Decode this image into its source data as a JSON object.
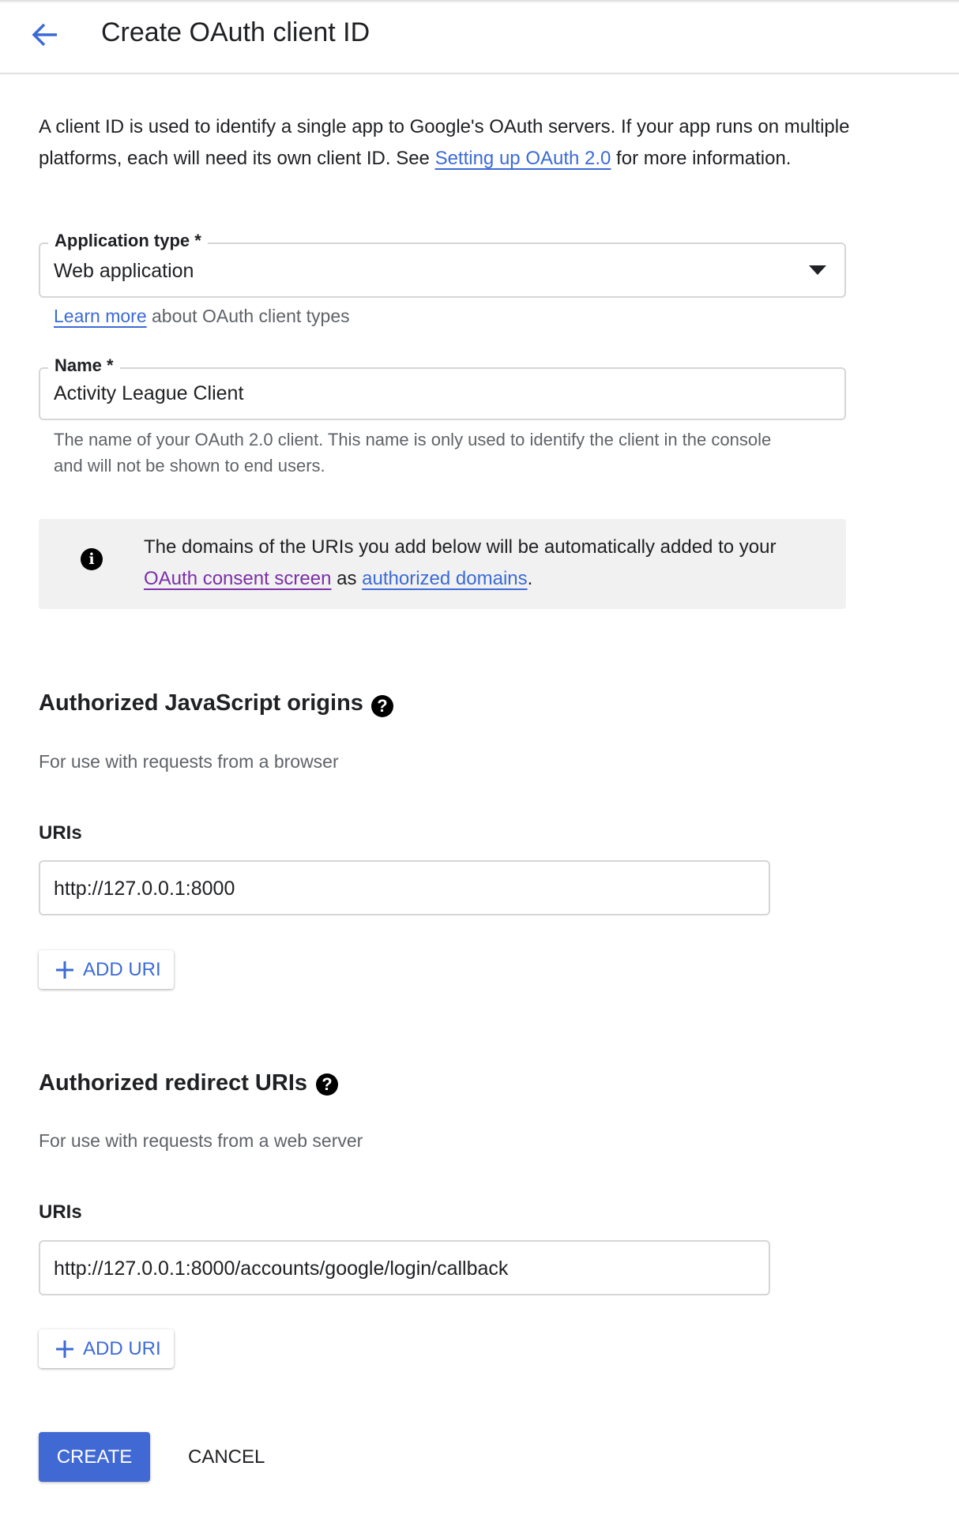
{
  "header": {
    "title": "Create OAuth client ID",
    "back_icon": "arrow-left-icon"
  },
  "intro": {
    "text_before": "A client ID is used to identify a single app to Google's OAuth servers. If your app runs on multiple platforms, each will need its own client ID. See ",
    "link": "Setting up OAuth 2.0",
    "text_after": " for more information."
  },
  "app_type": {
    "label": "Application type *",
    "value": "Web application",
    "learn_more": "Learn more",
    "learn_more_rest": " about OAuth client types"
  },
  "name": {
    "label": "Name *",
    "value": "Activity League Client",
    "helper": "The name of your OAuth 2.0 client. This name is only used to identify the client in the console and will not be shown to end users."
  },
  "info": {
    "text1": "The domains of the URIs you add below will be automatically added to your ",
    "link1": "OAuth consent screen",
    "text2": " as ",
    "link2": "authorized domains",
    "text3": "."
  },
  "js_origins": {
    "title": "Authorized JavaScript origins",
    "subtitle": "For use with requests from a browser",
    "uris_label": "URIs",
    "uri": "http://127.0.0.1:8000",
    "add_label": "ADD URI"
  },
  "redirect": {
    "title": "Authorized redirect URIs",
    "subtitle": "For use with requests from a web server",
    "uris_label": "URIs",
    "uri": "http://127.0.0.1:8000/accounts/google/login/callback",
    "add_label": "ADD URI"
  },
  "actions": {
    "create": "CREATE",
    "cancel": "CANCEL"
  },
  "colors": {
    "accent": "#4169d4",
    "link": "#3c6bd6",
    "visited_link": "#7b2fa8",
    "info_bg": "#f1f1f1"
  }
}
